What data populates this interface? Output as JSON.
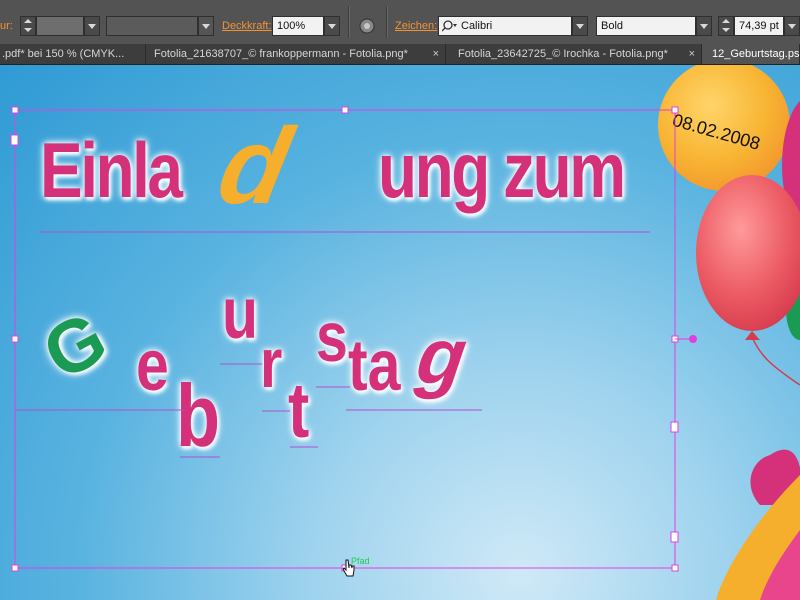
{
  "control_bar": {
    "partial_label": "ur:",
    "opacity_label": "Deckkraft:",
    "opacity_value": "100%",
    "character_label": "Zeichen:",
    "font_family": "Calibri",
    "font_style": "Bold",
    "font_size": "74,39 pt"
  },
  "tabs": [
    {
      "label": ".pdf* bei 150 % (CMYK..."
    },
    {
      "label": "Fotolia_21638707_© frankoppermann - Fotolia.png*"
    },
    {
      "label": "Fotolia_23642725_© Irochka - Fotolia.png*"
    },
    {
      "label": "12_Geburtstag.ps"
    }
  ],
  "tab_close_glyph": "×",
  "artwork": {
    "line1": [
      "Einla",
      "d",
      "ung zum"
    ],
    "line2": [
      "G",
      "e",
      "b",
      "u",
      "r",
      "t",
      "s",
      "ta",
      "g"
    ],
    "date": "08.02.2008",
    "path_label": "Pfad"
  },
  "colors": {
    "accent_orange": "#f39233",
    "letter_pink": "#d4317a",
    "letter_green": "#1a9a52",
    "letter_orange": "#f6ae2d",
    "selection_magenta": "#e040e0",
    "path_label_green": "#19d04a"
  }
}
